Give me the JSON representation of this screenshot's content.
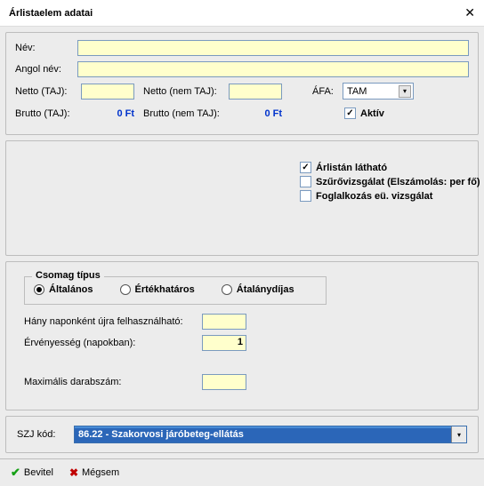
{
  "window": {
    "title": "Árlistaelem adatai"
  },
  "basic": {
    "name_label": "Név:",
    "enname_label": "Angol név:",
    "netto_taj_label": "Netto (TAJ):",
    "netto_nemtaj_label": "Netto (nem TAJ):",
    "brutto_taj_label": "Brutto (TAJ):",
    "brutto_nemtaj_label": "Brutto (nem TAJ):",
    "brutto_taj_val": "0 Ft",
    "brutto_nemtaj_val": "0 Ft",
    "afa_label": "ÁFA:",
    "afa_value": "TAM",
    "aktiv_label": "Aktív"
  },
  "options": {
    "visible_label": "Árlistán látható",
    "screening_label": "Szűrővizsgálat (Elszámolás: per fő)",
    "occup_label": "Foglalkozás eü. vizsgálat"
  },
  "package": {
    "legend": "Csomag típus",
    "r_general": "Általános",
    "r_limit": "Értékhatáros",
    "r_flat": "Átalánydíjas",
    "reuse_label": "Hány naponként újra felhasználható:",
    "validity_label": "Érvényesség (napokban):",
    "validity_val": "1",
    "max_label": "Maximális darabszám:"
  },
  "szj": {
    "label": "SZJ kód:",
    "value": "86.22 - Szakorvosi járóbeteg-ellátás"
  },
  "buttons": {
    "ok": "Bevitel",
    "cancel": "Mégsem"
  }
}
